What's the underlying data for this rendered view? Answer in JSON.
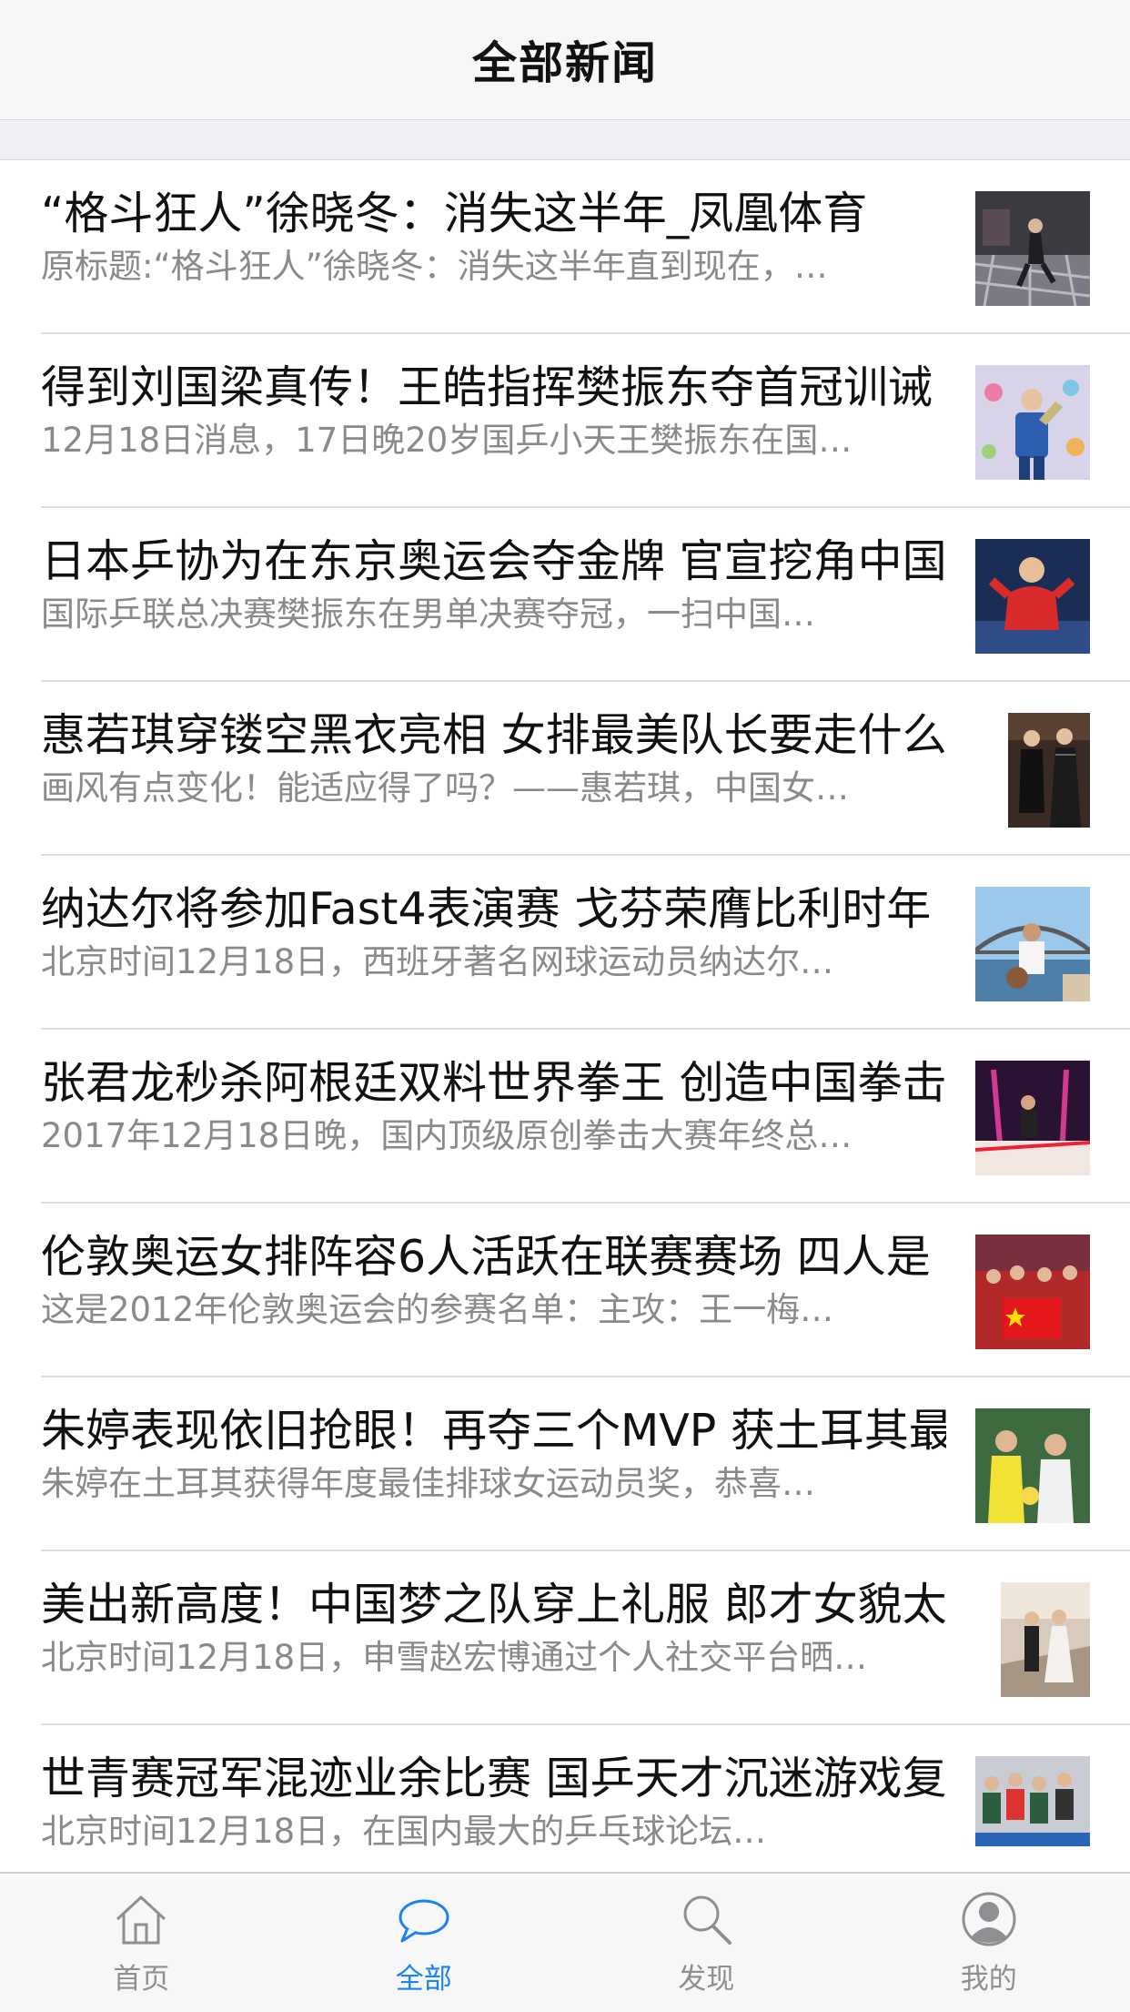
{
  "nav": {
    "title": "全部新闻"
  },
  "news": [
    {
      "title": "“格斗狂人”徐晓冬：消失这半年_凤凰体育",
      "summary": "原标题:“格斗狂人”徐晓冬：消失这半年直到现在，…",
      "thumb": "boxing-ring-photo"
    },
    {
      "title": "得到刘国梁真传！王皓指挥樊振东夺首冠训诫",
      "summary": "12月18日消息，17日晚20岁国乒小天王樊振东在国…",
      "thumb": "player-trophy-photo"
    },
    {
      "title": "日本乒协为在东京奥运会夺金牌 官宣挖角中国",
      "summary": "国际乒联总决赛樊振东在男单决赛夺冠，一扫中国…",
      "thumb": "coach-red-shirt-photo"
    },
    {
      "title": "惠若琪穿镂空黑衣亮相 女排最美队长要走什么",
      "summary": "画风有点变化！能适应得了吗？——惠若琪，中国女…",
      "thumb": "red-carpet-photo"
    },
    {
      "title": "纳达尔将参加Fast4表演赛 戈芬荣膺比利时年",
      "summary": "北京时间12月18日，西班牙著名网球运动员纳达尔…",
      "thumb": "harbour-bridge-photo"
    },
    {
      "title": "张君龙秒杀阿根廷双料世界拳王 创造中国拳击",
      "summary": "2017年12月18日晚，国内顶级原创拳击大赛年终总…",
      "thumb": "boxing-match-photo"
    },
    {
      "title": "伦敦奥运女排阵容6人活跃在联赛赛场 四人是",
      "summary": "这是2012年伦敦奥运会的参赛名单：主攻：王一梅…",
      "thumb": "team-flag-photo"
    },
    {
      "title": "朱婷表现依旧抢眼！再夺三个MVP 获土耳其最",
      "summary": "朱婷在土耳其获得年度最佳排球女运动员奖，恭喜…",
      "thumb": "volleyball-players-photo"
    },
    {
      "title": "美出新高度！中国梦之队穿上礼服 郎才女貌太",
      "summary": "北京时间12月18日，申雪赵宏博通过个人社交平台晒…",
      "thumb": "formal-dress-photo"
    },
    {
      "title": "世青赛冠军混迹业余比赛 国乒天才沉迷游戏复",
      "summary": "北京时间12月18日，在国内最大的乒乓球论坛…",
      "thumb": "table-tennis-team-photo"
    }
  ],
  "tabs": [
    {
      "label": "首页",
      "icon": "home-icon",
      "active": false
    },
    {
      "label": "全部",
      "icon": "chat-bubble-icon",
      "active": true
    },
    {
      "label": "发现",
      "icon": "search-icon",
      "active": false
    },
    {
      "label": "我的",
      "icon": "user-icon",
      "active": false
    }
  ],
  "colors": {
    "accent": "#1a82f2",
    "inactive": "#8e8e93",
    "summary": "#8a8a8a"
  }
}
